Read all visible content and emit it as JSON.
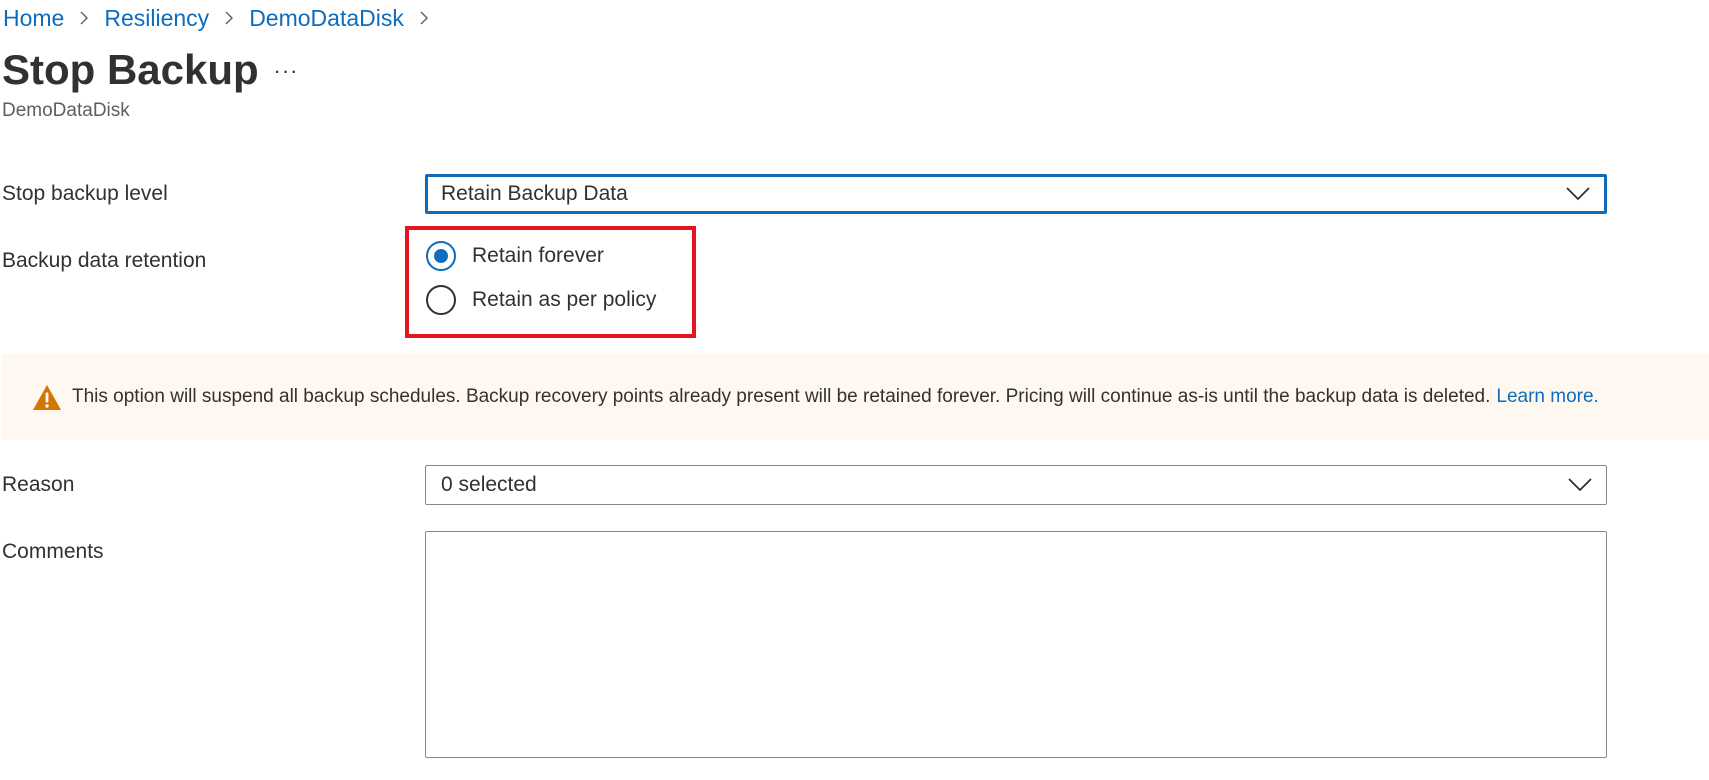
{
  "breadcrumb": {
    "items": [
      {
        "label": "Home"
      },
      {
        "label": "Resiliency"
      },
      {
        "label": "DemoDataDisk"
      }
    ]
  },
  "header": {
    "title": "Stop Backup",
    "more_label": "···",
    "subtitle": "DemoDataDisk"
  },
  "form": {
    "stop_backup_level": {
      "label": "Stop backup level",
      "value": "Retain Backup Data"
    },
    "retention": {
      "label": "Backup data retention",
      "options": [
        {
          "label": "Retain forever",
          "selected": true
        },
        {
          "label": "Retain as per policy",
          "selected": false
        }
      ]
    },
    "warning": {
      "text": "This option will suspend all backup schedules. Backup recovery points already present will be retained forever. Pricing will continue as-is until the backup data is deleted.",
      "link": "Learn more."
    },
    "reason": {
      "label": "Reason",
      "value": "0 selected"
    },
    "comments": {
      "label": "Comments",
      "value": "",
      "placeholder": ""
    }
  },
  "colors": {
    "accent": "#0f6cbd",
    "highlight": "#e3161f",
    "warning_bg": "#fff8f0",
    "warning_icon": "#d47500"
  },
  "icons": {
    "breadcrumb_separator": "chevron-right-icon",
    "dropdown": "chevron-down-icon",
    "warning": "warning-icon"
  }
}
